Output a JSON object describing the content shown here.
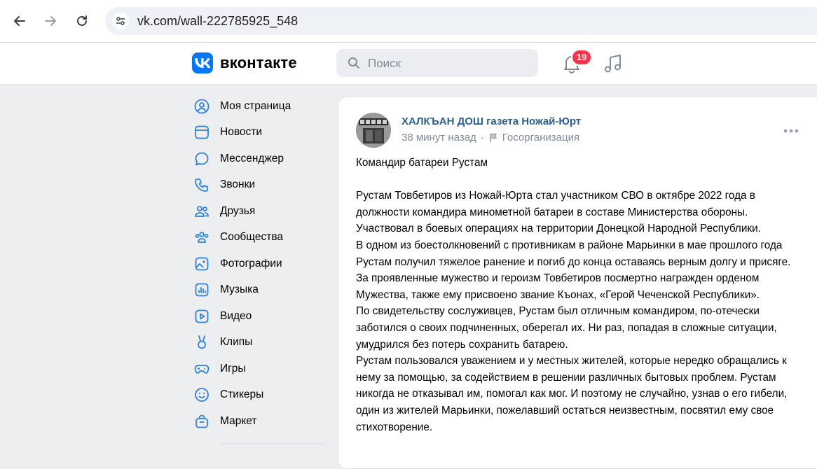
{
  "browser": {
    "url": "vk.com/wall-222785925_548",
    "back_icon": "arrow-left-icon",
    "forward_icon": "arrow-right-icon",
    "reload_icon": "reload-icon",
    "site_info_icon": "tune-icon"
  },
  "header": {
    "logo_text": "вконтакте",
    "search_placeholder": "Поиск",
    "notifications_count": "19",
    "brand_color": "#0077ff",
    "badge_color": "#ff3347"
  },
  "sidebar": {
    "items": [
      {
        "label": "Моя страница",
        "icon": "user-circle-icon"
      },
      {
        "label": "Новости",
        "icon": "news-icon"
      },
      {
        "label": "Мессенджер",
        "icon": "message-icon"
      },
      {
        "label": "Звонки",
        "icon": "phone-icon"
      },
      {
        "label": "Друзья",
        "icon": "friends-icon"
      },
      {
        "label": "Сообщества",
        "icon": "communities-icon"
      },
      {
        "label": "Фотографии",
        "icon": "photo-icon"
      },
      {
        "label": "Музыка",
        "icon": "music-icon"
      },
      {
        "label": "Видео",
        "icon": "video-icon"
      },
      {
        "label": "Клипы",
        "icon": "clips-icon"
      },
      {
        "label": "Игры",
        "icon": "gamepad-icon"
      },
      {
        "label": "Стикеры",
        "icon": "sticker-icon"
      },
      {
        "label": "Маркет",
        "icon": "market-icon"
      }
    ]
  },
  "post": {
    "author": "ХАЛКЪАН ДОШ газета Ножай-Юрт",
    "time": "38 минут назад",
    "separator": "·",
    "category": "Госорганизация",
    "title_line": "Командир батареи Рустам",
    "paragraphs": [
      "Рустам Товбетиров из Ножай-Юрта стал участником СВО в октябре 2022 года в должности командира минометной батареи в составе Министерства обороны. Участвовал в боевых операциях на территории Донецкой Народной Республики.",
      "В одном из боестолкновений с противникам в районе Марьинки в мае прошлого года Рустам получил тяжелое ранение и погиб до конца оставаясь верным долгу и присяге.",
      "За проявленные мужество и героизм Товбетиров посмертно награжден орденом Мужества, также ему присвоено звание Къонах, «Герой Чеченской Республики».",
      "По свидетельству сослуживцев, Рустам был отличным командиром, по-отечески заботился о своих подчиненных, оберегал их. Ни раз, попадая в сложные ситуации, умудрился без потерь сохранить батарею.",
      "Рустам пользовался уважением и у местных жителей, которые нередко обращались к нему за помощью, за содействием в решении различных бытовых проблем. Рустам никогда не отказывал им, помогал как мог. И поэтому не случайно, узнав о его гибели, один из жителей Марьинки, пожелавший остаться неизвестным, посвятил ему свое стихотворение."
    ]
  }
}
